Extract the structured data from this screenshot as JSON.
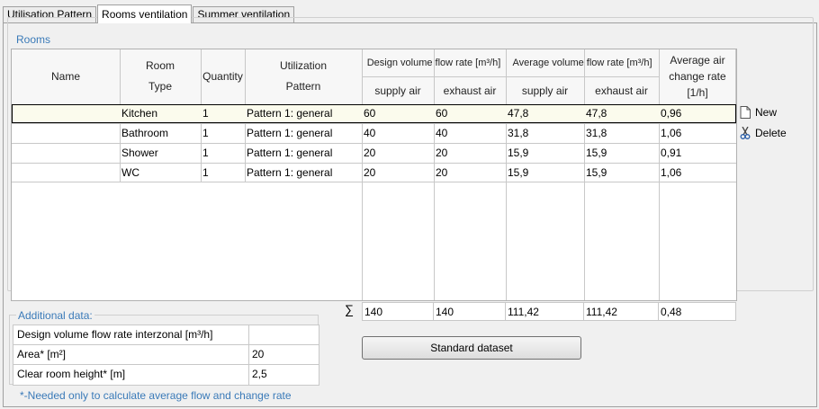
{
  "tabs": [
    {
      "label": "Utilisation Pattern"
    },
    {
      "label": "Rooms ventilation"
    },
    {
      "label": "Summer ventilation"
    }
  ],
  "rooms_group": {
    "title": "Rooms"
  },
  "headers": {
    "name": "Name",
    "room_type_1": "Room",
    "room_type_2": "Type",
    "quantity": "Quantity",
    "utilization_1": "Utilization",
    "utilization_2": "Pattern",
    "design_flow": "Design volume flow rate [m³/h]",
    "average_flow": "Average volume flow rate [m³/h]",
    "supply_air": "supply air",
    "exhaust_air": "exhaust air",
    "change_rate_1": "Average air",
    "change_rate_2": "change rate",
    "change_rate_3": "[1/h]"
  },
  "rows": [
    {
      "name": "",
      "type": "Kitchen",
      "quantity": "1",
      "pattern": "Pattern 1: general",
      "design_supply": "60",
      "design_exhaust": "60",
      "avg_supply": "47,8",
      "avg_exhaust": "47,8",
      "change_rate": "0,96"
    },
    {
      "name": "",
      "type": "Bathroom",
      "quantity": "1",
      "pattern": "Pattern 1: general",
      "design_supply": "40",
      "design_exhaust": "40",
      "avg_supply": "31,8",
      "avg_exhaust": "31,8",
      "change_rate": "1,06"
    },
    {
      "name": "",
      "type": "Shower",
      "quantity": "1",
      "pattern": "Pattern 1: general",
      "design_supply": "20",
      "design_exhaust": "20",
      "avg_supply": "15,9",
      "avg_exhaust": "15,9",
      "change_rate": "0,91"
    },
    {
      "name": "",
      "type": "WC",
      "quantity": "1",
      "pattern": "Pattern 1: general",
      "design_supply": "20",
      "design_exhaust": "20",
      "avg_supply": "15,9",
      "avg_exhaust": "15,9",
      "change_rate": "1,06"
    }
  ],
  "actions": {
    "new_label": "New",
    "delete_label": "Delete"
  },
  "sums": {
    "symbol": "∑",
    "design_supply": "140",
    "design_exhaust": "140",
    "avg_supply": "111,42",
    "avg_exhaust": "111,42",
    "change_rate": "0,48"
  },
  "additional": {
    "title": "Additional data:",
    "rows": [
      {
        "label": "Design volume flow rate interzonal  [m³/h]",
        "value": ""
      },
      {
        "label": "Area*  [m²]",
        "value": "20"
      },
      {
        "label": "Clear room height*  [m]",
        "value": "2,5"
      }
    ]
  },
  "standard_button": "Standard dataset",
  "note": "*-Needed only to calculate average flow and change rate"
}
